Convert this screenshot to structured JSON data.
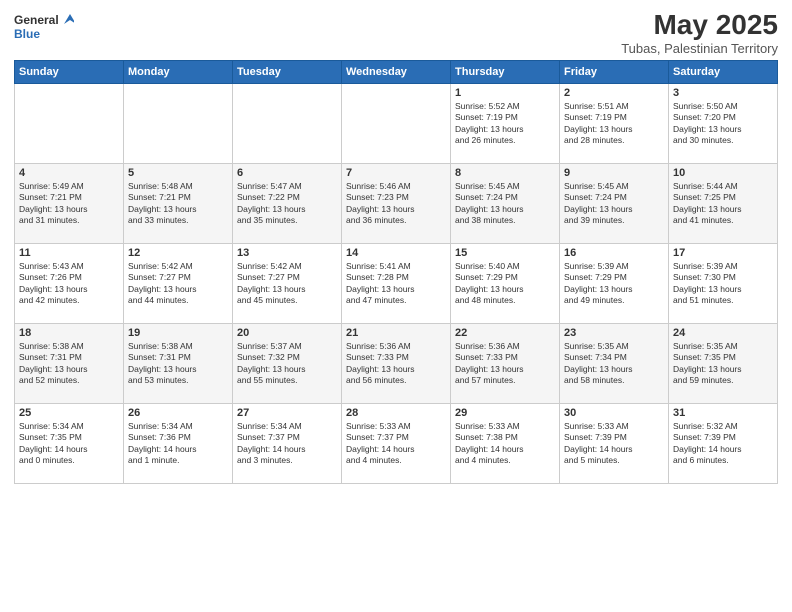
{
  "header": {
    "logo_general": "General",
    "logo_blue": "Blue",
    "month_year": "May 2025",
    "location": "Tubas, Palestinian Territory"
  },
  "days_of_week": [
    "Sunday",
    "Monday",
    "Tuesday",
    "Wednesday",
    "Thursday",
    "Friday",
    "Saturday"
  ],
  "weeks": [
    [
      {
        "day": "",
        "info": ""
      },
      {
        "day": "",
        "info": ""
      },
      {
        "day": "",
        "info": ""
      },
      {
        "day": "",
        "info": ""
      },
      {
        "day": "1",
        "info": "Sunrise: 5:52 AM\nSunset: 7:19 PM\nDaylight: 13 hours\nand 26 minutes."
      },
      {
        "day": "2",
        "info": "Sunrise: 5:51 AM\nSunset: 7:19 PM\nDaylight: 13 hours\nand 28 minutes."
      },
      {
        "day": "3",
        "info": "Sunrise: 5:50 AM\nSunset: 7:20 PM\nDaylight: 13 hours\nand 30 minutes."
      }
    ],
    [
      {
        "day": "4",
        "info": "Sunrise: 5:49 AM\nSunset: 7:21 PM\nDaylight: 13 hours\nand 31 minutes."
      },
      {
        "day": "5",
        "info": "Sunrise: 5:48 AM\nSunset: 7:21 PM\nDaylight: 13 hours\nand 33 minutes."
      },
      {
        "day": "6",
        "info": "Sunrise: 5:47 AM\nSunset: 7:22 PM\nDaylight: 13 hours\nand 35 minutes."
      },
      {
        "day": "7",
        "info": "Sunrise: 5:46 AM\nSunset: 7:23 PM\nDaylight: 13 hours\nand 36 minutes."
      },
      {
        "day": "8",
        "info": "Sunrise: 5:45 AM\nSunset: 7:24 PM\nDaylight: 13 hours\nand 38 minutes."
      },
      {
        "day": "9",
        "info": "Sunrise: 5:45 AM\nSunset: 7:24 PM\nDaylight: 13 hours\nand 39 minutes."
      },
      {
        "day": "10",
        "info": "Sunrise: 5:44 AM\nSunset: 7:25 PM\nDaylight: 13 hours\nand 41 minutes."
      }
    ],
    [
      {
        "day": "11",
        "info": "Sunrise: 5:43 AM\nSunset: 7:26 PM\nDaylight: 13 hours\nand 42 minutes."
      },
      {
        "day": "12",
        "info": "Sunrise: 5:42 AM\nSunset: 7:27 PM\nDaylight: 13 hours\nand 44 minutes."
      },
      {
        "day": "13",
        "info": "Sunrise: 5:42 AM\nSunset: 7:27 PM\nDaylight: 13 hours\nand 45 minutes."
      },
      {
        "day": "14",
        "info": "Sunrise: 5:41 AM\nSunset: 7:28 PM\nDaylight: 13 hours\nand 47 minutes."
      },
      {
        "day": "15",
        "info": "Sunrise: 5:40 AM\nSunset: 7:29 PM\nDaylight: 13 hours\nand 48 minutes."
      },
      {
        "day": "16",
        "info": "Sunrise: 5:39 AM\nSunset: 7:29 PM\nDaylight: 13 hours\nand 49 minutes."
      },
      {
        "day": "17",
        "info": "Sunrise: 5:39 AM\nSunset: 7:30 PM\nDaylight: 13 hours\nand 51 minutes."
      }
    ],
    [
      {
        "day": "18",
        "info": "Sunrise: 5:38 AM\nSunset: 7:31 PM\nDaylight: 13 hours\nand 52 minutes."
      },
      {
        "day": "19",
        "info": "Sunrise: 5:38 AM\nSunset: 7:31 PM\nDaylight: 13 hours\nand 53 minutes."
      },
      {
        "day": "20",
        "info": "Sunrise: 5:37 AM\nSunset: 7:32 PM\nDaylight: 13 hours\nand 55 minutes."
      },
      {
        "day": "21",
        "info": "Sunrise: 5:36 AM\nSunset: 7:33 PM\nDaylight: 13 hours\nand 56 minutes."
      },
      {
        "day": "22",
        "info": "Sunrise: 5:36 AM\nSunset: 7:33 PM\nDaylight: 13 hours\nand 57 minutes."
      },
      {
        "day": "23",
        "info": "Sunrise: 5:35 AM\nSunset: 7:34 PM\nDaylight: 13 hours\nand 58 minutes."
      },
      {
        "day": "24",
        "info": "Sunrise: 5:35 AM\nSunset: 7:35 PM\nDaylight: 13 hours\nand 59 minutes."
      }
    ],
    [
      {
        "day": "25",
        "info": "Sunrise: 5:34 AM\nSunset: 7:35 PM\nDaylight: 14 hours\nand 0 minutes."
      },
      {
        "day": "26",
        "info": "Sunrise: 5:34 AM\nSunset: 7:36 PM\nDaylight: 14 hours\nand 1 minute."
      },
      {
        "day": "27",
        "info": "Sunrise: 5:34 AM\nSunset: 7:37 PM\nDaylight: 14 hours\nand 3 minutes."
      },
      {
        "day": "28",
        "info": "Sunrise: 5:33 AM\nSunset: 7:37 PM\nDaylight: 14 hours\nand 4 minutes."
      },
      {
        "day": "29",
        "info": "Sunrise: 5:33 AM\nSunset: 7:38 PM\nDaylight: 14 hours\nand 4 minutes."
      },
      {
        "day": "30",
        "info": "Sunrise: 5:33 AM\nSunset: 7:39 PM\nDaylight: 14 hours\nand 5 minutes."
      },
      {
        "day": "31",
        "info": "Sunrise: 5:32 AM\nSunset: 7:39 PM\nDaylight: 14 hours\nand 6 minutes."
      }
    ]
  ]
}
